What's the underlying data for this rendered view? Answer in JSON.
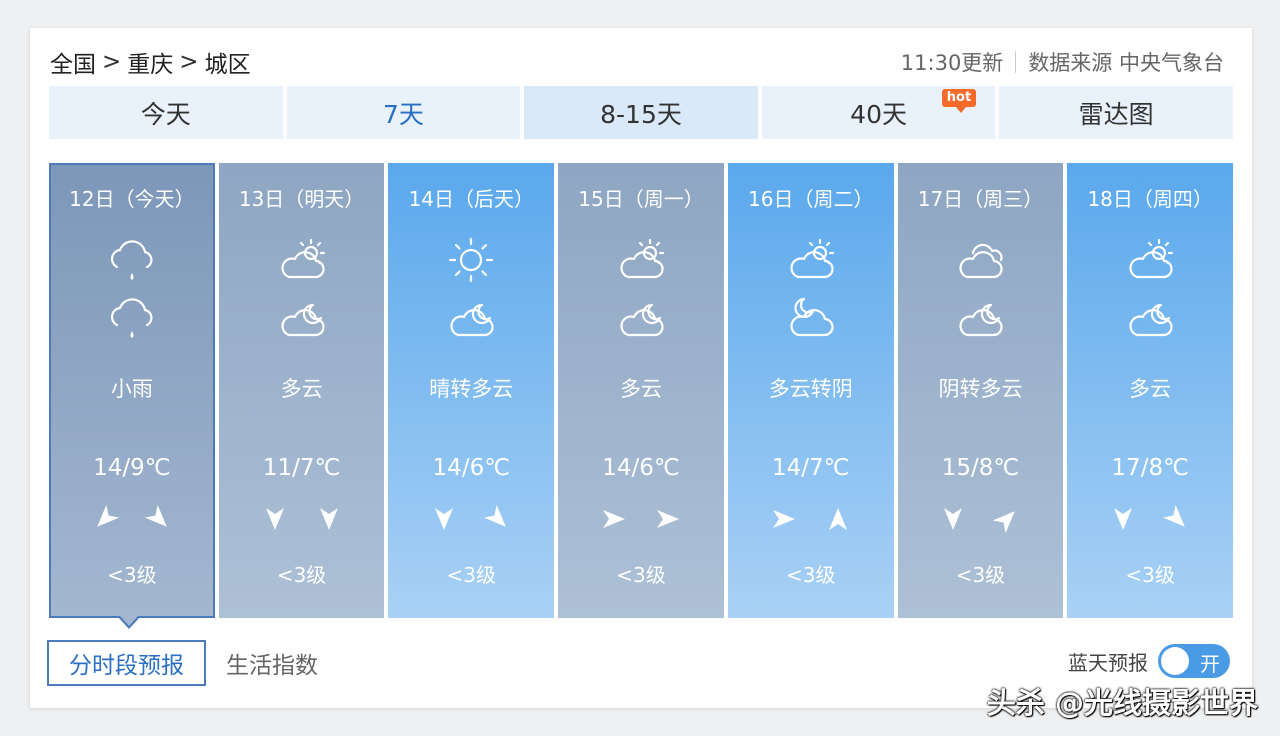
{
  "breadcrumb": {
    "items": [
      "全国",
      "重庆",
      "城区"
    ],
    "separator": ">"
  },
  "update": {
    "time_text": "11:30更新",
    "source_text": "数据来源 中央气象台"
  },
  "tabs": [
    {
      "label": "今天"
    },
    {
      "label": "7天"
    },
    {
      "label": "8-15天"
    },
    {
      "label": "40天",
      "badge": "hot"
    },
    {
      "label": "雷达图"
    }
  ],
  "days": [
    {
      "title": "12日（今天）",
      "day_icon": "light-rain-icon",
      "night_icon": "light-rain-icon",
      "desc": "小雨",
      "temp": "14/9℃",
      "wind_day": "northeast-wind-icon",
      "wind_night": "northwest-wind-icon",
      "level": "<3级"
    },
    {
      "title": "13日（明天）",
      "day_icon": "partly-cloudy-day-icon",
      "night_icon": "partly-cloudy-night-icon",
      "desc": "多云",
      "temp": "11/7℃",
      "wind_day": "north-wind-icon",
      "wind_night": "north-wind-icon",
      "level": "<3级"
    },
    {
      "title": "14日（后天）",
      "day_icon": "sunny-icon",
      "night_icon": "partly-cloudy-night-icon",
      "desc": "晴转多云",
      "temp": "14/6℃",
      "wind_day": "north-wind-icon",
      "wind_night": "northwest-wind-icon",
      "level": "<3级"
    },
    {
      "title": "15日（周一）",
      "day_icon": "partly-cloudy-day-icon",
      "night_icon": "partly-cloudy-night-icon",
      "desc": "多云",
      "temp": "14/6℃",
      "wind_day": "west-wind-icon",
      "wind_night": "west-wind-icon",
      "level": "<3级"
    },
    {
      "title": "16日（周二）",
      "day_icon": "partly-cloudy-day-icon",
      "night_icon": "overcast-night-icon",
      "desc": "多云转阴",
      "temp": "14/7℃",
      "wind_day": "west-wind-icon",
      "wind_night": "south-wind-icon",
      "level": "<3级"
    },
    {
      "title": "17日（周三）",
      "day_icon": "overcast-icon",
      "night_icon": "partly-cloudy-night-icon",
      "desc": "阴转多云",
      "temp": "15/8℃",
      "wind_day": "north-wind-icon",
      "wind_night": "southwest-wind-icon",
      "level": "<3级"
    },
    {
      "title": "18日（周四）",
      "day_icon": "partly-cloudy-day-icon",
      "night_icon": "partly-cloudy-night-icon",
      "desc": "多云",
      "temp": "17/8℃",
      "wind_day": "north-wind-icon",
      "wind_night": "northwest-wind-icon",
      "level": "<3级"
    }
  ],
  "subtabs": [
    {
      "label": "分时段预报"
    },
    {
      "label": "生活指数"
    }
  ],
  "sky_forecast": {
    "label": "蓝天预报",
    "toggle_text": "开"
  },
  "watermark": "头杀 @光线摄影世界",
  "colors": {
    "accent": "#2a6fc4",
    "hot": "#f46b2c",
    "gray_card": "#8ea6c3",
    "blue_card": "#5aa8ec",
    "toggle": "#4a9be6"
  }
}
